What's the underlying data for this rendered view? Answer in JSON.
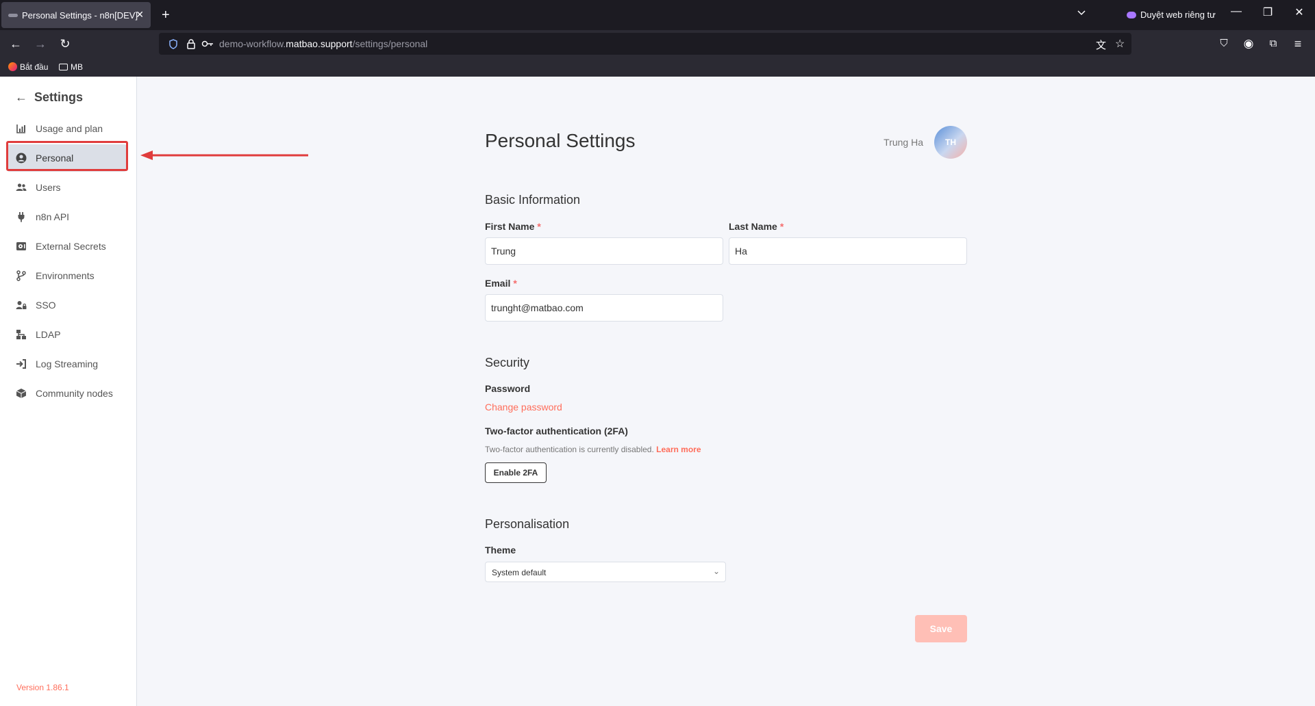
{
  "browser": {
    "tab_title": "Personal Settings - n8n[DEV]",
    "tab_close": "✕",
    "new_tab": "+",
    "private_label": "Duyệt web riêng tư",
    "url_host_prefix": "demo-workflow.",
    "url_host_domain": "matbao.support",
    "url_path": "/settings/personal",
    "bookmarks": [
      "Bắt đầu",
      "MB"
    ]
  },
  "sidebar": {
    "title": "Settings",
    "items": [
      {
        "label": "Usage and plan",
        "icon": "chart-icon"
      },
      {
        "label": "Personal",
        "icon": "user-circle-icon"
      },
      {
        "label": "Users",
        "icon": "users-icon"
      },
      {
        "label": "n8n API",
        "icon": "plug-icon"
      },
      {
        "label": "External Secrets",
        "icon": "vault-icon"
      },
      {
        "label": "Environments",
        "icon": "branch-icon"
      },
      {
        "label": "SSO",
        "icon": "user-lock-icon"
      },
      {
        "label": "LDAP",
        "icon": "network-icon"
      },
      {
        "label": "Log Streaming",
        "icon": "sign-in-icon"
      },
      {
        "label": "Community nodes",
        "icon": "cube-icon"
      }
    ],
    "active_item": "Personal",
    "version": "Version 1.86.1"
  },
  "page": {
    "title": "Personal Settings",
    "user_name": "Trung Ha",
    "avatar_initials": "TH",
    "basic_info": {
      "heading": "Basic Information",
      "first_name_label": "First Name",
      "first_name_value": "Trung",
      "last_name_label": "Last Name",
      "last_name_value": "Ha",
      "email_label": "Email",
      "email_value": "trunght@matbao.com",
      "required_mark": "*"
    },
    "security": {
      "heading": "Security",
      "password_label": "Password",
      "change_password": "Change password",
      "twofa_label": "Two-factor authentication (2FA)",
      "twofa_hint": "Two-factor authentication is currently disabled.",
      "learn_more": "Learn more",
      "enable_2fa": "Enable 2FA"
    },
    "personalisation": {
      "heading": "Personalisation",
      "theme_label": "Theme",
      "theme_value": "System default"
    },
    "save_label": "Save"
  },
  "colors": {
    "accent": "#ff6d5a",
    "annotation": "#e03c3c",
    "chrome_dark": "#1c1b22",
    "save_disabled": "#ffbfb6"
  }
}
